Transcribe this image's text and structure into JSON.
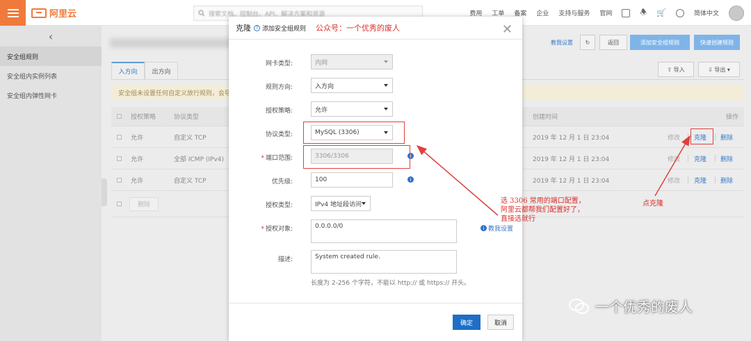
{
  "topbar": {
    "brand": "阿里云",
    "search_placeholder": "搜索文档、控制台、API、解决方案和资源",
    "nav": [
      "费用",
      "工单",
      "备案",
      "企业",
      "支持与服务",
      "官网"
    ],
    "language": "简体中文"
  },
  "sidebar": {
    "items": [
      "安全组规则",
      "安全组内实例列表",
      "安全组内弹性网卡"
    ]
  },
  "main": {
    "actions": {
      "tutorial": "教我设置",
      "back": "返回",
      "add_rule": "添加安全组规则",
      "quick_create": "快速创建规则"
    },
    "tabs": [
      "入方向",
      "出方向"
    ],
    "import": "导入",
    "export": "导出",
    "notice": "安全组未设置任何自定义放行规则，会导致",
    "table": {
      "headers": [
        "授权策略",
        "协议类型",
        "创建时间",
        "操作"
      ],
      "rows": [
        {
          "policy": "允许",
          "protocol": "自定义 TCP",
          "time": "2019 年 12 月 1 日 23:04",
          "modify": "修改",
          "clone": "克隆",
          "delete": "删除"
        },
        {
          "policy": "允许",
          "protocol": "全部 ICMP (IPv4)",
          "time": "2019 年 12 月 1 日 23:04",
          "modify": "修改",
          "clone": "克隆",
          "delete": "删除"
        },
        {
          "policy": "允许",
          "protocol": "自定义 TCP",
          "time": "2019 年 12 月 1 日 23:04",
          "modify": "修改",
          "clone": "克隆",
          "delete": "删除"
        }
      ],
      "bulk_delete": "删除"
    }
  },
  "modal": {
    "title": "克隆",
    "help_link": "添加安全组规则",
    "annotation_title": "公众号：一个优秀的废人",
    "fields": {
      "nic_type": {
        "label": "网卡类型:",
        "value": "内网"
      },
      "direction": {
        "label": "规则方向:",
        "value": "入方向"
      },
      "policy": {
        "label": "授权策略:",
        "value": "允许"
      },
      "protocol": {
        "label": "协议类型:",
        "value": "MySQL (3306)"
      },
      "port_range": {
        "label": "端口范围:",
        "value": "3306/3306"
      },
      "priority": {
        "label": "优先级:",
        "value": "100"
      },
      "auth_type": {
        "label": "授权类型:",
        "value": "IPv4 地址段访问"
      },
      "auth_object": {
        "label": "授权对象:",
        "value": "0.0.0.0/0"
      },
      "description": {
        "label": "描述:",
        "value": "System created rule."
      }
    },
    "tutorial": "教我设置",
    "hint": "长度为 2-256 个字符，不能以 http:// 或 https:// 开头。",
    "ok": "确定",
    "cancel": "取消"
  },
  "annotations": {
    "port_note": [
      "选 3306 常用的端口配置，",
      "阿里云都帮我们配置好了，",
      "直接选就行"
    ],
    "clone_note": "点克隆",
    "color": "#d9302c"
  },
  "watermark": "一个优秀的废人"
}
